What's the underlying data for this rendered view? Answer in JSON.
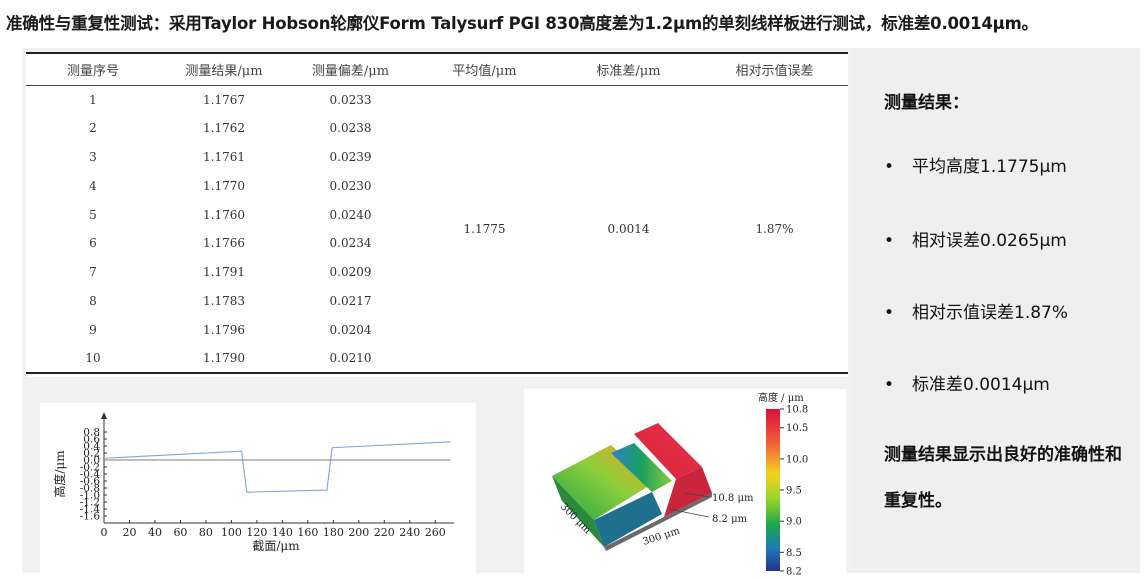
{
  "title": "准确性与重复性测试：采用Taylor Hobson轮廓仪Form Talysurf PGI 830高度差为1.2μm的单刻线样板进行测试，标准差0.0014μm。",
  "table": {
    "headers": [
      "测量序号",
      "测量结果/μm",
      "测量偏差/μm",
      "平均值/μm",
      "标准差/μm",
      "相对示值误差"
    ],
    "rows": [
      [
        "1",
        "1.1767",
        "0.0233"
      ],
      [
        "2",
        "1.1762",
        "0.0238"
      ],
      [
        "3",
        "1.1761",
        "0.0239"
      ],
      [
        "4",
        "1.1770",
        "0.0230"
      ],
      [
        "5",
        "1.1760",
        "0.0240"
      ],
      [
        "6",
        "1.1766",
        "0.0234"
      ],
      [
        "7",
        "1.1791",
        "0.0209"
      ],
      [
        "8",
        "1.1783",
        "0.0217"
      ],
      [
        "9",
        "1.1796",
        "0.0204"
      ],
      [
        "10",
        "1.1790",
        "0.0210"
      ]
    ],
    "merged": {
      "mean": "1.1775",
      "std": "0.0014",
      "rel_error": "1.87%"
    }
  },
  "chart_data": [
    {
      "type": "line",
      "xlabel": "截面/μm",
      "ylabel": "高度/μm",
      "xlim": [
        0,
        270
      ],
      "ylim": [
        -1.8,
        1.0
      ],
      "xticks": [
        "0",
        "20",
        "40",
        "60",
        "80",
        "100",
        "120",
        "140",
        "160",
        "180",
        "200",
        "220",
        "240",
        "260"
      ],
      "yticks": [
        "0.8",
        "0.6",
        "0.4",
        "0.2",
        "0.0",
        "-0.2",
        "-0.4",
        "-0.6",
        "-0.8",
        "-1.0",
        "-1.2",
        "-1.4",
        "-1.6"
      ],
      "series": [
        {
          "color": "#7aa6d8",
          "x": [
            0,
            108,
            112,
            175,
            179,
            272
          ],
          "y": [
            0.05,
            0.25,
            -0.92,
            -0.86,
            0.35,
            0.52
          ]
        },
        {
          "color": "#7d7d7d",
          "x": [
            0,
            272
          ],
          "y": [
            0.0,
            0.0
          ]
        }
      ]
    },
    {
      "type": "heatmap",
      "colorbar_title": "高度 / μm",
      "colorbar_ticks": [
        "10.8",
        "10.5",
        "10.0",
        "9.5",
        "9.0",
        "8.5",
        "8.2"
      ],
      "range": [
        8.2,
        10.8
      ],
      "labels": [
        "300 μm",
        "300 μm",
        "10.8 μm",
        "8.2 μm"
      ]
    }
  ],
  "right": {
    "heading": "测量结果：",
    "bullets": [
      "平均高度1.1775μm",
      "相对误差0.0265μm",
      "相对示值误差1.87%",
      "标准差0.0014μm"
    ],
    "bullet_char": "•",
    "conclusion": "测量结果显示出良好的准确性和重复性。"
  }
}
